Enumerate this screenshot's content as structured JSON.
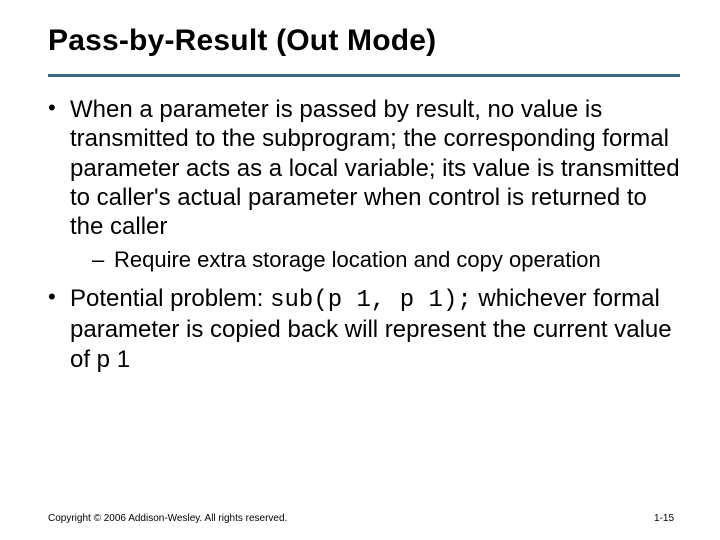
{
  "slide": {
    "title": "Pass-by-Result (Out Mode)",
    "bullets": [
      {
        "text": "When a parameter is passed by result, no value is transmitted to the subprogram; the corresponding formal parameter acts as a local variable; its value is transmitted to caller's actual parameter when control is returned to the caller",
        "sub": [
          "Require extra storage location and copy operation"
        ]
      },
      {
        "prefix": "Potential problem: ",
        "code": "sub(p 1, p 1);",
        "suffix": " whichever formal parameter is copied back will represent the current value of p 1"
      }
    ],
    "footer": {
      "copyright": "Copyright © 2006 Addison-Wesley. All rights reserved.",
      "page": "1-15"
    }
  }
}
